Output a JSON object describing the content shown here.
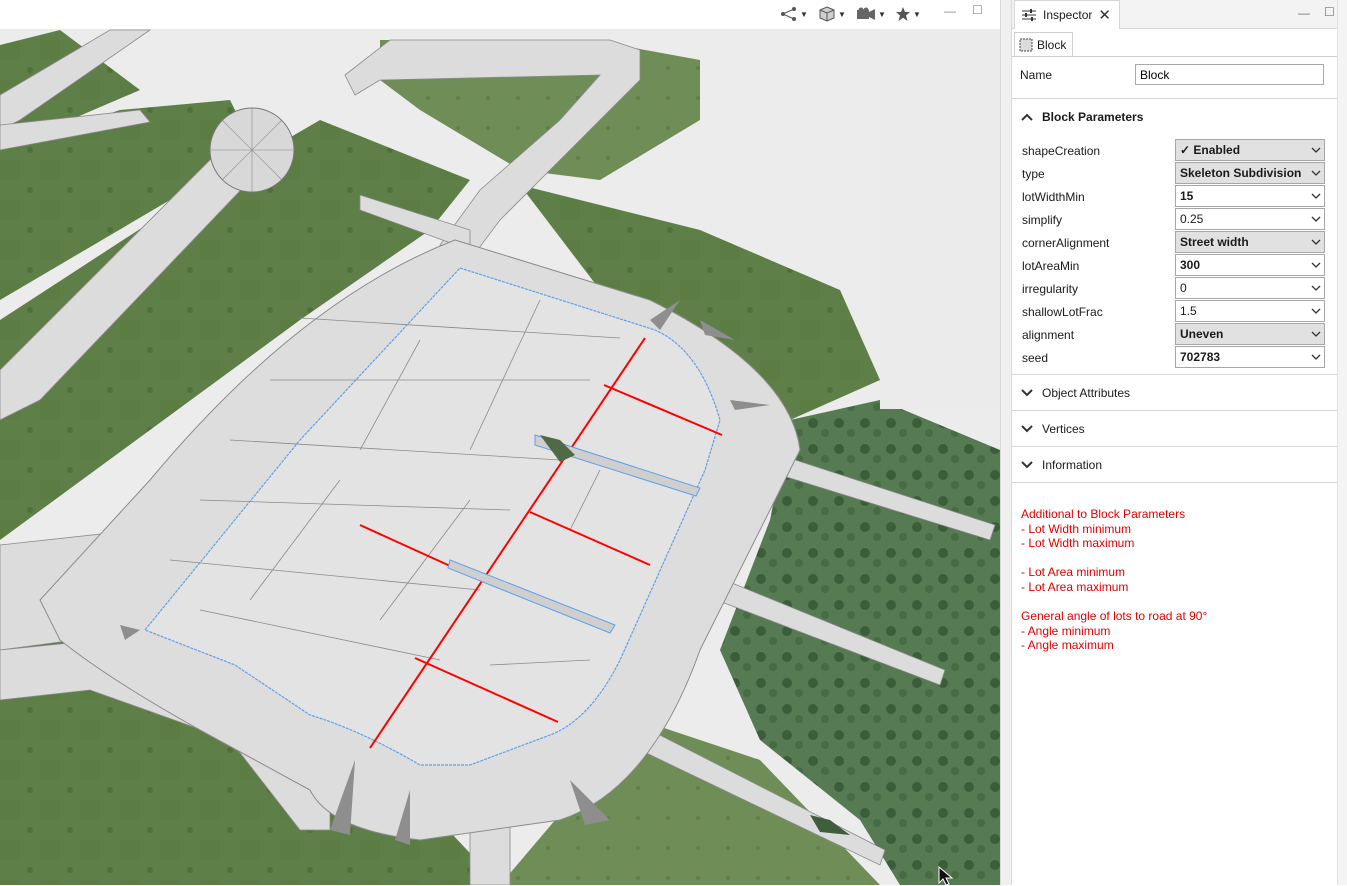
{
  "inspector": {
    "tab_label": "Inspector",
    "subtab_label": "Block",
    "name_label": "Name",
    "name_value": "Block",
    "sections": {
      "block_parameters": "Block Parameters",
      "object_attributes": "Object Attributes",
      "vertices": "Vertices",
      "information": "Information"
    },
    "params": [
      {
        "name": "shapeCreation",
        "value": "✓ Enabled",
        "style": "gray-bold"
      },
      {
        "name": "type",
        "value": "Skeleton Subdivision",
        "style": "gray-bold"
      },
      {
        "name": "lotWidthMin",
        "value": "15",
        "style": "white-bold"
      },
      {
        "name": "simplify",
        "value": "0.25",
        "style": "white"
      },
      {
        "name": "cornerAlignment",
        "value": "Street width",
        "style": "gray-bold"
      },
      {
        "name": "lotAreaMin",
        "value": "300",
        "style": "white-bold"
      },
      {
        "name": "irregularity",
        "value": "0",
        "style": "white"
      },
      {
        "name": "shallowLotFrac",
        "value": "1.5",
        "style": "white"
      },
      {
        "name": "alignment",
        "value": "Uneven",
        "style": "gray-bold"
      },
      {
        "name": "seed",
        "value": "702783",
        "style": "white-bold"
      }
    ],
    "notes": [
      "Additional to Block Parameters",
      "- Lot Width minimum",
      "- Lot Width maximum",
      "",
      "- Lot Area minimum",
      "- Lot Area maximum",
      "",
      "General angle of lots to road at 90°",
      "- Angle minimum",
      "- Angle maximum"
    ]
  },
  "viewport": {
    "toolbar_icons": [
      "graph-icon",
      "cube-icon",
      "camera-icon",
      "star-icon"
    ]
  },
  "colors": {
    "notes_text": "#e00000",
    "lot_lines": "#ff0000",
    "block_outline": "#5fa0e8",
    "terrain": "#5b7a45",
    "street": "#dedede"
  }
}
